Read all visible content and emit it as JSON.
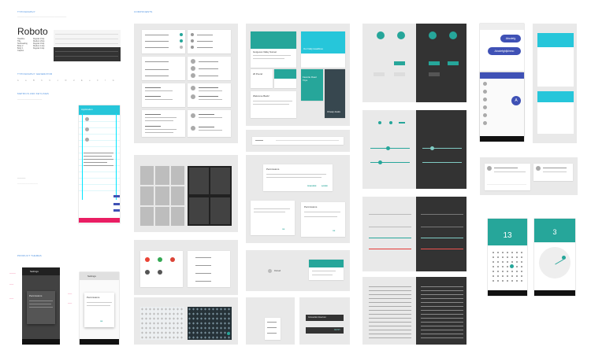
{
  "sections": {
    "typography": "TYPOGRAPHY",
    "typography_generator": "TYPOGRAPHY GENERATOR",
    "metrics": "METRICS AND KEYLINES",
    "product_themes": "PRODUCT THEMES",
    "components": "COMPONENTS"
  },
  "type_sample": {
    "family": "Roboto",
    "scale": [
      "Headline",
      "Title",
      "Subheading",
      "Body 2",
      "Body 1",
      "Caption",
      "Button"
    ],
    "scale_right": [
      "Regular 24sp",
      "Medium 20sp",
      "Regular 16sp",
      "Medium 14sp",
      "Regular 14sp",
      "Regular 12sp",
      "MEDIUM (ALL CAPS) 14sp"
    ]
  },
  "phones": {
    "app_title": "Application",
    "settings_title": "Settings",
    "dialog_title": "Permissions",
    "bubble_1": "Abcdefg",
    "bubble_2": "Abcdefghijklmno",
    "fab_letter": "A",
    "cal_day": "13",
    "clock_hour": "3"
  },
  "cards": {
    "sunset_title": "Sunset",
    "header_a": "Gorgeous Valley Sunset",
    "header_b": "Our Daily Headlines",
    "item_c": "20 Pound",
    "item_d": "Favorite Road Trips",
    "welcome": "Welcome Back!",
    "cheap_deals": "Cheap deals",
    "permissions": "Permissions",
    "reload": "Reload",
    "snackbar_msg": "Connection timed out",
    "snackbar_action": "RETRY"
  },
  "actions": {
    "agree": "AGREE",
    "disagree": "DISAGREE",
    "ok": "OK",
    "cancel": "CANCEL",
    "learn_more": "LEARN MORE"
  },
  "colors": {
    "teal": "#26a69a",
    "cyan": "#26c6da",
    "blue": "#3f51b5",
    "pink": "#e91e63",
    "dark": "#333333",
    "panel": "#e9e9e9"
  }
}
